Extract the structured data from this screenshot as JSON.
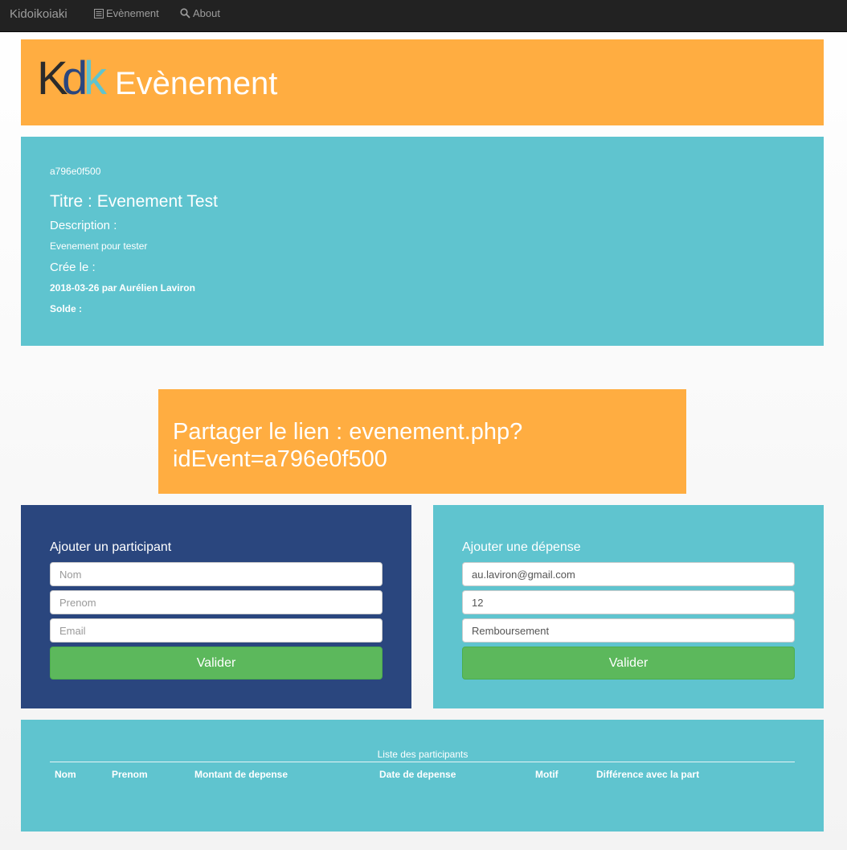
{
  "navbar": {
    "brand": "Kidoikoiaki",
    "links": [
      {
        "label": "Evènement",
        "icon": "list-icon"
      },
      {
        "label": "About",
        "icon": "search-icon"
      }
    ]
  },
  "header": {
    "logo_text": "Kdk",
    "title": "Evènement"
  },
  "event": {
    "id": "a796e0f500",
    "title": "Titre : Evenement Test",
    "description_label": "Description :",
    "description": "Evenement pour tester",
    "created_label": "Crée le :",
    "created": "2018-03-26 par Aurélien Laviron",
    "solde_label": "Solde :"
  },
  "share": {
    "text": "Partager le lien : evenement.php?idEvent=a796e0f500"
  },
  "add_participant": {
    "title": "Ajouter un participant",
    "fields": [
      {
        "placeholder": "Nom",
        "value": ""
      },
      {
        "placeholder": "Prenom",
        "value": ""
      },
      {
        "placeholder": "Email",
        "value": ""
      }
    ],
    "button": "Valider"
  },
  "add_expense": {
    "title": "Ajouter une dépense",
    "fields": [
      {
        "placeholder": "",
        "value": "au.laviron@gmail.com"
      },
      {
        "placeholder": "",
        "value": "12"
      },
      {
        "placeholder": "",
        "value": "Remboursement"
      }
    ],
    "button": "Valider"
  },
  "participants_table": {
    "caption": "Liste des participants",
    "columns": [
      "Nom",
      "Prenom",
      "Montant de depense",
      "Date de depense",
      "Motif",
      "Différence avec la part"
    ],
    "rows": []
  },
  "colors": {
    "orange": "#ffad41",
    "teal": "#5fc4cf",
    "navy": "#2a467e",
    "success": "#5cb85c",
    "navbar": "#222222"
  }
}
